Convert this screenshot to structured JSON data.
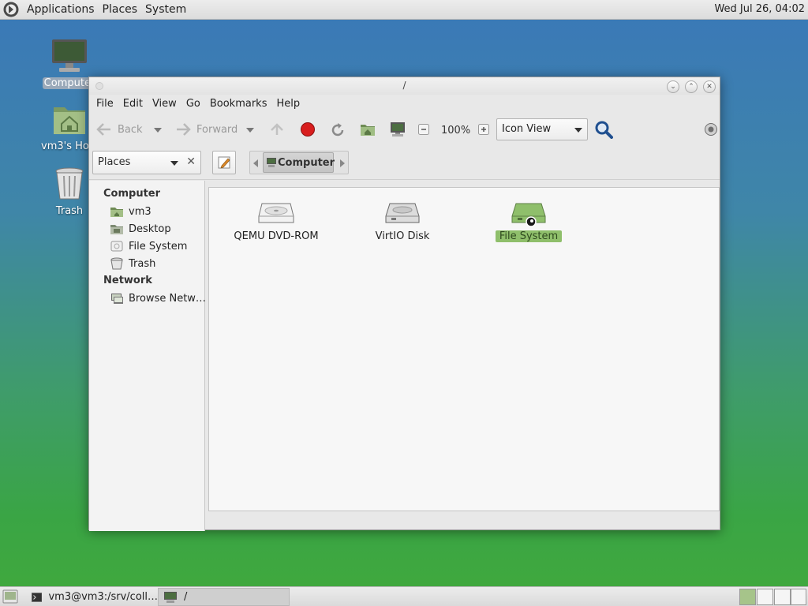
{
  "top_panel": {
    "menus": [
      "Applications",
      "Places",
      "System"
    ],
    "clock": "Wed Jul 26, 04:02"
  },
  "desktop_icons": [
    {
      "label": "Computer",
      "icon": "computer-monitor-icon"
    },
    {
      "label": "vm3's Home",
      "icon": "home-folder-icon"
    },
    {
      "label": "Trash",
      "icon": "trash-icon"
    }
  ],
  "window": {
    "title": "/",
    "menubar": [
      "File",
      "Edit",
      "View",
      "Go",
      "Bookmarks",
      "Help"
    ],
    "toolbar": {
      "back_label": "Back",
      "forward_label": "Forward",
      "zoom": "100%",
      "view_mode": "Icon View"
    },
    "location": {
      "places_label": "Places",
      "crumb_current": "Computer"
    },
    "sidebar": {
      "sections": [
        {
          "title": "Computer",
          "items": [
            "vm3",
            "Desktop",
            "File System",
            "Trash"
          ]
        },
        {
          "title": "Network",
          "items": [
            "Browse Netw…"
          ]
        }
      ]
    },
    "files": [
      {
        "label": "QEMU DVD-ROM",
        "icon": "optical-drive-icon",
        "selected": false
      },
      {
        "label": "VirtIO Disk",
        "icon": "hard-disk-icon",
        "selected": false
      },
      {
        "label": "File System",
        "icon": "filesystem-drive-icon",
        "selected": true
      }
    ]
  },
  "taskbar": {
    "tasks": [
      "vm3@vm3:/srv/coll…",
      "/"
    ],
    "workspaces": 4,
    "active_workspace": 1
  },
  "colors": {
    "selection_green": "#8fbf6b",
    "desktop_top": "#3a78b8",
    "desktop_bottom": "#41a93c"
  }
}
